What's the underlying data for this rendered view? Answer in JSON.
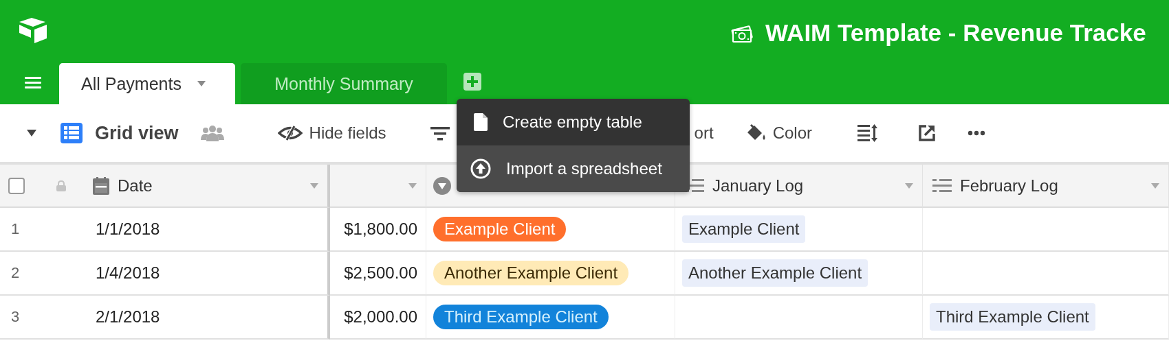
{
  "app": {
    "title": "WAIM Template - Revenue Tracke"
  },
  "tabs": [
    {
      "label": "All Payments",
      "selected": true
    },
    {
      "label": "Monthly Summary",
      "selected": false
    }
  ],
  "toolbar": {
    "view": "Grid view",
    "items": [
      {
        "kind": "hide",
        "label": "Hide fields"
      },
      {
        "kind": "filter"
      },
      {
        "kind": "sort",
        "label": "ort"
      },
      {
        "kind": "color",
        "label": "Color"
      },
      {
        "kind": "height"
      },
      {
        "kind": "share"
      },
      {
        "kind": "more"
      }
    ]
  },
  "menu": {
    "items": [
      {
        "kind": "create",
        "label": "Create empty table",
        "selected": false
      },
      {
        "kind": "import",
        "label": "Import a spreadsheet",
        "selected": true
      }
    ]
  },
  "table": {
    "select_all": {
      "checked": false
    },
    "columns": [
      {
        "kind": "date",
        "name": "Date"
      },
      {
        "kind": "currency"
      },
      {
        "kind": "select"
      },
      {
        "kind": "log",
        "name": "January Log"
      },
      {
        "kind": "log",
        "name": "February Log"
      }
    ],
    "rows": [
      {
        "number": "1",
        "date": "1/1/2018",
        "amount": "$1,800.00",
        "revenue_stream": {
          "label": "Example Client",
          "color": "#ff6f2c"
        },
        "january_log": "Example Client"
      },
      {
        "number": "2",
        "date": "1/4/2018",
        "amount": "$2,500.00",
        "revenue_stream": {
          "label": "Another Example Client",
          "color": "#ffeab6"
        },
        "january_log": "Another Example Client"
      },
      {
        "number": "3",
        "date": "2/1/2018",
        "amount": "$2,000.00",
        "revenue_stream": {
          "label": "Third Example Client",
          "color": "#1283da"
        },
        "february_log": "Third Example Client"
      }
    ]
  }
}
